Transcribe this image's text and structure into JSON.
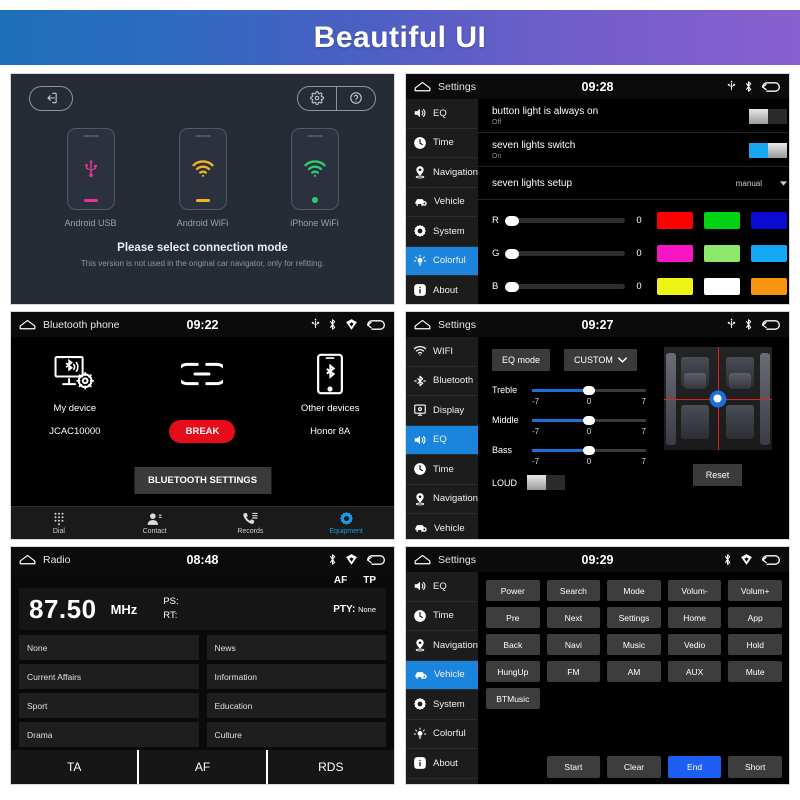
{
  "banner": {
    "title": "Beautiful UI"
  },
  "panel_connection": {
    "exit_icon": "exit-icon",
    "gear_icon": "gear-icon",
    "help_icon": "help-icon",
    "options": [
      {
        "label": "Android USB",
        "icon": "usb-icon",
        "color": "#e8329b"
      },
      {
        "label": "Android WiFi",
        "icon": "wifi-icon",
        "color": "#f0b323"
      },
      {
        "label": "iPhone WiFi",
        "icon": "wifi-icon",
        "color": "#2ecc71"
      }
    ],
    "headline": "Please select connection mode",
    "subtext": "This version is not used in the original car navigator, only for refitting."
  },
  "panel_colorful": {
    "status": {
      "title": "Settings",
      "time": "09:28",
      "icons": [
        "usb-icon",
        "bluetooth-icon",
        "back-icon"
      ]
    },
    "menu": [
      {
        "label": "EQ",
        "icon": "speaker-icon",
        "active": false
      },
      {
        "label": "Time",
        "icon": "clock-icon",
        "active": false
      },
      {
        "label": "Navigation",
        "icon": "location-pin-icon",
        "active": false
      },
      {
        "label": "Vehicle",
        "icon": "car-icon",
        "active": false
      },
      {
        "label": "System",
        "icon": "gear-icon",
        "active": false
      },
      {
        "label": "Colorful",
        "icon": "bulb-icon",
        "active": true
      },
      {
        "label": "About",
        "icon": "info-icon",
        "active": false
      }
    ],
    "rows": [
      {
        "title": "button light is always on",
        "sub": "Off",
        "toggle": "off"
      },
      {
        "title": "seven lights switch",
        "sub": "On",
        "toggle": "on"
      }
    ],
    "dropdown_row": {
      "title": "seven lights setup",
      "value": "manual",
      "icon": "chevron-down-icon"
    },
    "channels": [
      {
        "label": "R",
        "value": "0"
      },
      {
        "label": "G",
        "value": "0"
      },
      {
        "label": "B",
        "value": "0"
      }
    ],
    "swatches": [
      [
        "#ff0000",
        "#00d215",
        "#0a0ad2"
      ],
      [
        "#f915c6",
        "#8ee86b",
        "#17a8f5"
      ],
      [
        "#eff513",
        "#ffffff",
        "#f79510"
      ]
    ]
  },
  "panel_bluetooth": {
    "status": {
      "title": "Bluetooth phone",
      "time": "09:22",
      "icons": [
        "usb-icon",
        "bluetooth-icon",
        "gps-icon",
        "back-icon"
      ]
    },
    "my_device": {
      "title": "My device",
      "name": "JCAC10000",
      "icon": "bt-monitor-settings-icon"
    },
    "link": {
      "icon": "link-icon",
      "button": "BREAK"
    },
    "other_devices": {
      "title": "Other devices",
      "name": "Honor 8A",
      "icon": "bt-phone-icon"
    },
    "settings_button": "BLUETOOTH SETTINGS",
    "nav": [
      {
        "label": "Dial",
        "icon": "keypad-icon",
        "active": false
      },
      {
        "label": "Contact",
        "icon": "contact-icon",
        "active": false
      },
      {
        "label": "Records",
        "icon": "call-records-icon",
        "active": false
      },
      {
        "label": "Equipment",
        "icon": "gear-icon",
        "active": true
      }
    ]
  },
  "panel_eq": {
    "status": {
      "title": "Settings",
      "time": "09:27",
      "icons": [
        "usb-icon",
        "bluetooth-icon",
        "back-icon"
      ]
    },
    "menu": [
      {
        "label": "WIFI",
        "icon": "wifi-icon",
        "active": false
      },
      {
        "label": "Bluetooth",
        "icon": "bluetooth-icon",
        "active": false
      },
      {
        "label": "Display",
        "icon": "display-icon",
        "active": false
      },
      {
        "label": "EQ",
        "icon": "speaker-icon",
        "active": true
      },
      {
        "label": "Time",
        "icon": "clock-icon",
        "active": false
      },
      {
        "label": "Navigation",
        "icon": "location-pin-icon",
        "active": false
      },
      {
        "label": "Vehicle",
        "icon": "car-icon",
        "active": false
      }
    ],
    "eq_mode_button": "EQ mode",
    "eq_preset": {
      "value": "CUSTOM",
      "icon": "chevron-down-icon"
    },
    "sliders": [
      {
        "label": "Treble",
        "min": "-7",
        "mid": "0",
        "max": "7",
        "value": "0"
      },
      {
        "label": "Middle",
        "min": "-7",
        "mid": "0",
        "max": "7",
        "value": "0"
      },
      {
        "label": "Bass",
        "min": "-7",
        "mid": "0",
        "max": "7",
        "value": "0"
      }
    ],
    "loud": {
      "label": "LOUD",
      "toggle": "off"
    },
    "reset_button": "Reset",
    "fader_icon": "fader-crosshair-icon"
  },
  "panel_radio": {
    "status": {
      "title": "Radio",
      "time": "08:48",
      "icons": [
        "bluetooth-icon",
        "gps-icon",
        "back-icon"
      ]
    },
    "flags": [
      "AF",
      "TP"
    ],
    "frequency": "87.50",
    "unit": "MHz",
    "ps_label": "PS:",
    "rt_label": "RT:",
    "pty_label": "PTY:",
    "pty_value": "None",
    "pty_types": [
      "None",
      "News",
      "Current Affairs",
      "Information",
      "Sport",
      "Education",
      "Drama",
      "Culture"
    ],
    "footer": [
      "TA",
      "AF",
      "RDS"
    ]
  },
  "panel_vehicle": {
    "status": {
      "title": "Settings",
      "time": "09:29",
      "icons": [
        "bluetooth-icon",
        "gps-icon",
        "back-icon"
      ]
    },
    "menu": [
      {
        "label": "EQ",
        "icon": "speaker-icon",
        "active": false
      },
      {
        "label": "Time",
        "icon": "clock-icon",
        "active": false
      },
      {
        "label": "Navigation",
        "icon": "location-pin-icon",
        "active": false
      },
      {
        "label": "Vehicle",
        "icon": "car-icon",
        "active": true
      },
      {
        "label": "System",
        "icon": "gear-icon",
        "active": false
      },
      {
        "label": "Colorful",
        "icon": "bulb-icon",
        "active": false
      },
      {
        "label": "About",
        "icon": "info-icon",
        "active": false
      }
    ],
    "keys": [
      "Power",
      "Search",
      "Mode",
      "Volum-",
      "Volum+",
      "Pre",
      "Next",
      "Settings",
      "Home",
      "App",
      "Back",
      "Navi",
      "Music",
      "Vedio",
      "Hold",
      "HungUp",
      "FM",
      "AM",
      "AUX",
      "Mute"
    ],
    "keys_last_row": [
      "BTMusic"
    ],
    "footer_keys": [
      {
        "label": "Start",
        "accent": false
      },
      {
        "label": "Clear",
        "accent": false
      },
      {
        "label": "End",
        "accent": true
      },
      {
        "label": "Short",
        "accent": false
      }
    ]
  }
}
